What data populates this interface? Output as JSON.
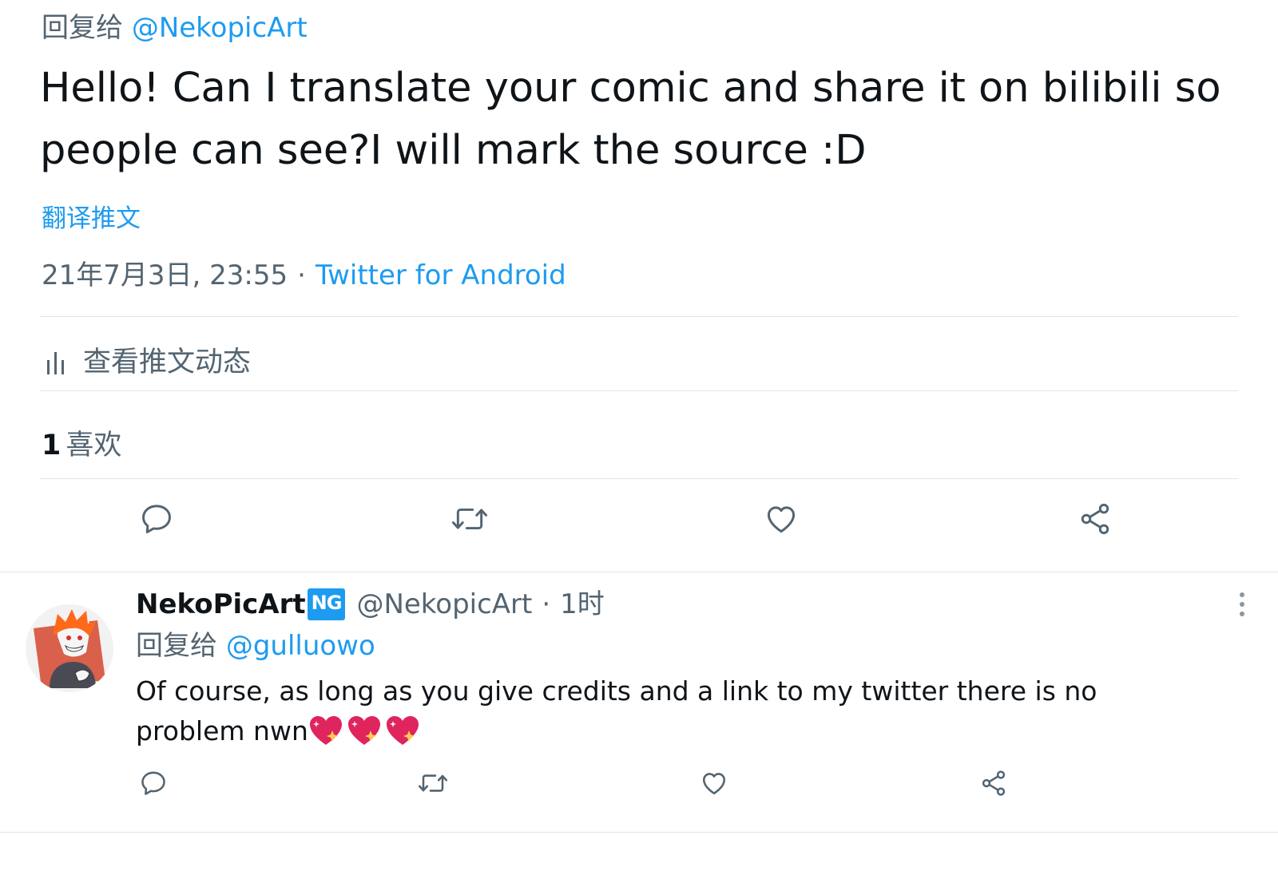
{
  "main_tweet": {
    "reply_prefix": "回复给",
    "reply_handle": "@NekopicArt",
    "text": "Hello! Can I translate your comic and share it on bilibili so people can see?I will mark the source :D",
    "translate_label": "翻译推文",
    "timestamp": "21年7月3日, 23:55",
    "separator": "·",
    "source": "Twitter for Android",
    "activity_label": "查看推文动态",
    "likes_count": "1",
    "likes_label": "喜欢"
  },
  "reply_tweet": {
    "display_name": "NekoPicArt",
    "badge": "NG",
    "handle": "@NekopicArt",
    "separator": "·",
    "time_ago": "1时",
    "reply_prefix": "回复给",
    "reply_handle": "@gulluowo",
    "text": "Of course, as long as you give credits and a link to my twitter there is no problem nwn",
    "emoji_count": 3
  },
  "icons": {
    "actions": [
      "reply-icon",
      "retweet-icon",
      "like-icon",
      "share-icon"
    ],
    "activity": "activity-bars-icon",
    "more": "more-vertical-icon",
    "emoji": "sparkling-heart-icon"
  },
  "colors": {
    "link": "#1d9bf0",
    "muted": "#536471",
    "text": "#0f1419",
    "divider": "#e1e6ea",
    "heart": "#e0245e"
  }
}
